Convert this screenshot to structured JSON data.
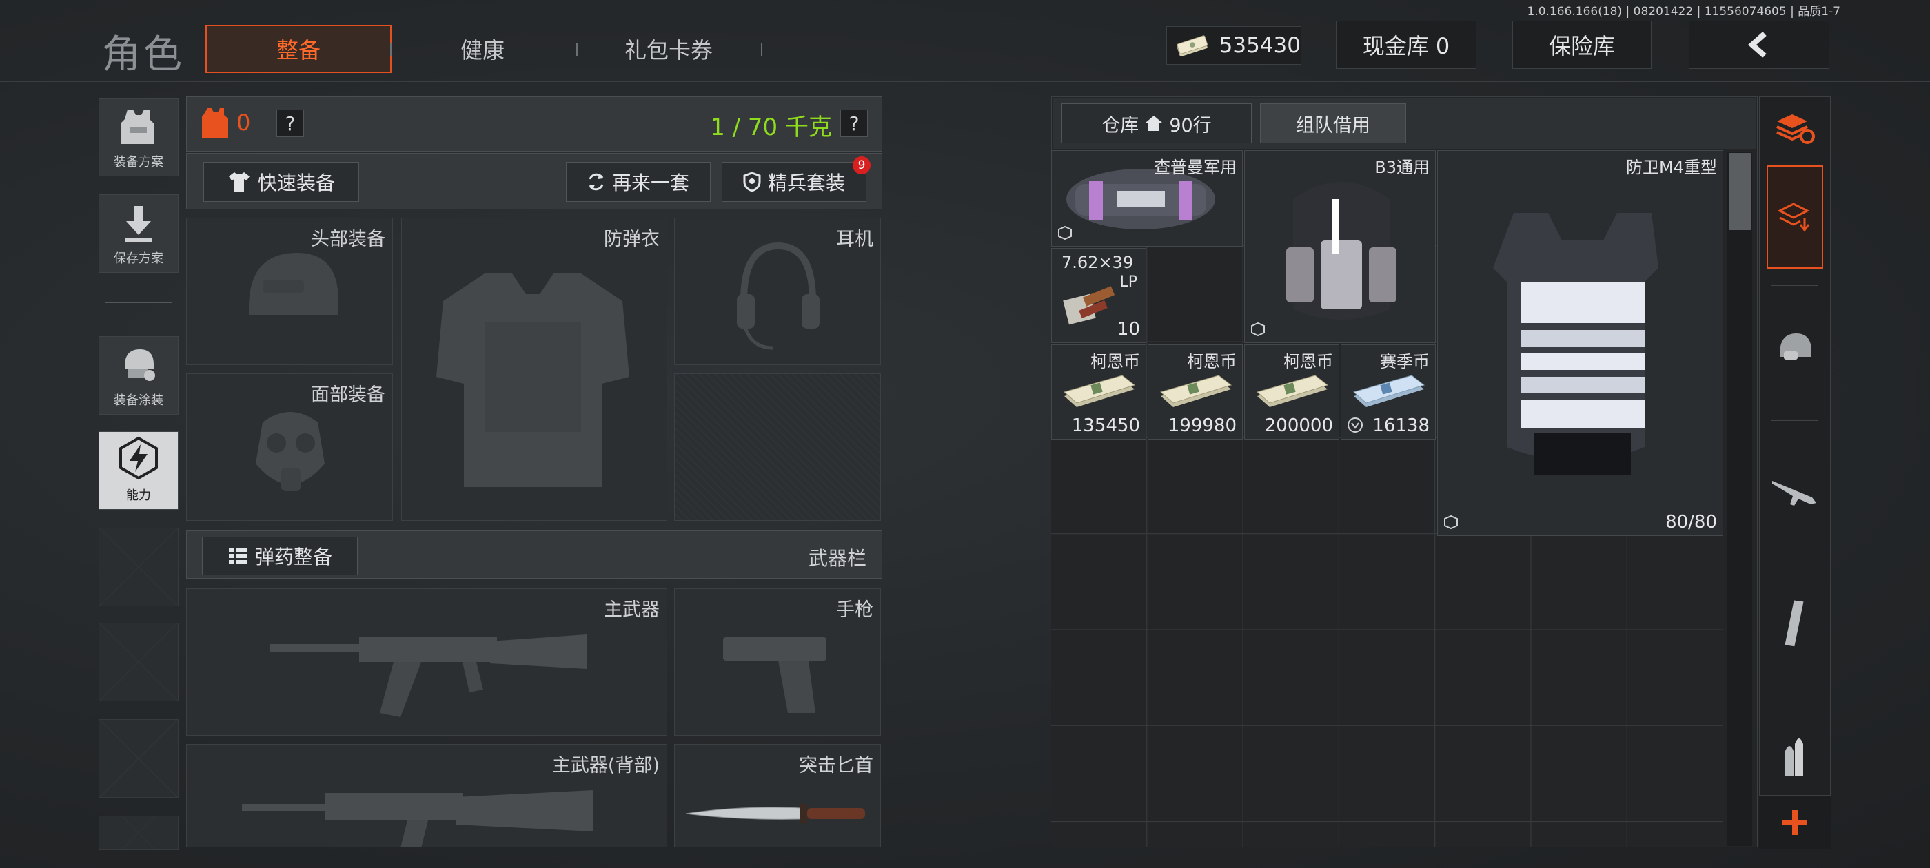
{
  "build_info": "1.0.166.166(18) | 08201422 | 11556074605 | 品质1-7",
  "header": {
    "title": "角色",
    "tabs": [
      {
        "label": "整备",
        "active": true
      },
      {
        "label": "健康",
        "active": false
      },
      {
        "label": "礼包卡券",
        "active": false
      }
    ],
    "currency_amount": "535430",
    "cash_vault": "现金库 0",
    "safe_box": "保险库",
    "back_icon": "chevron-left-icon"
  },
  "left_rail": {
    "items": [
      {
        "label": "装备方案",
        "icon": "vest-icon"
      },
      {
        "label": "保存方案",
        "icon": "download-icon"
      },
      {
        "label": "装备涂装",
        "icon": "paint-helmet-icon"
      },
      {
        "label": "能力",
        "icon": "ability-hex-icon",
        "selected": true
      }
    ]
  },
  "loadout": {
    "armor_count": "0",
    "help": "?",
    "weight": "1 / 70 千克",
    "quick_equip": "快速装备",
    "again": "再来一套",
    "elite_set": "精兵套装",
    "elite_badge": "9",
    "slots": {
      "head": "头部装备",
      "armor": "防弹衣",
      "headset": "耳机",
      "face": "面部装备"
    },
    "ammo_label": "弹药整备",
    "weapons_label": "武器栏",
    "weapon_slots": {
      "primary": "主武器",
      "pistol": "手枪",
      "primary_back": "主武器(背部)",
      "knife": "突击匕首"
    }
  },
  "inventory": {
    "warehouse_tab": "仓库",
    "rows": "90行",
    "team_borrow": "组队借用",
    "items": [
      {
        "name": "查普曼军用",
        "qty": ""
      },
      {
        "name": "B3通用",
        "qty": ""
      },
      {
        "name": "防卫M4重型",
        "qty": "80/80"
      },
      {
        "name": "7.62×39",
        "sub": "LP",
        "qty": "10"
      },
      {
        "name": "柯恩币",
        "qty": "135450"
      },
      {
        "name": "柯恩币",
        "qty": "199980"
      },
      {
        "name": "柯恩币",
        "qty": "200000"
      },
      {
        "name": "赛季币",
        "qty": "16138"
      }
    ]
  },
  "right_rail": {
    "icons": [
      "stack-refresh-icon",
      "stack-download-icon",
      "helmet-icon",
      "rifle-icon",
      "magazine-icon",
      "bullets-icon",
      "plus-icon"
    ]
  },
  "colors": {
    "accent": "#e8521f",
    "weight_green": "#8fdc1e",
    "badge_red": "#d82020"
  }
}
